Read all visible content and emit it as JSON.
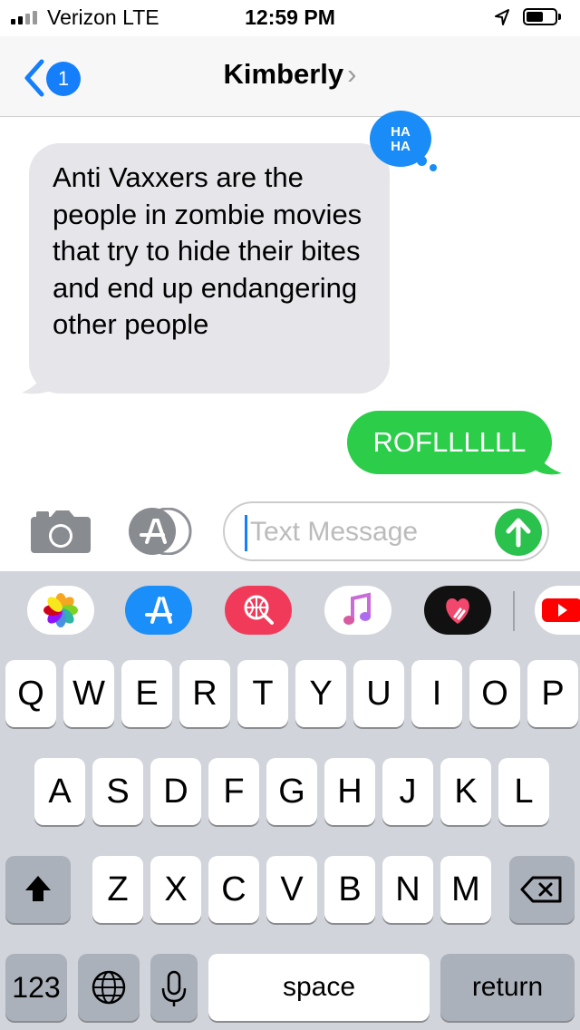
{
  "status_bar": {
    "carrier": "Verizon  LTE",
    "time": "12:59 PM"
  },
  "nav": {
    "back_count": "1",
    "contact": "Kimberly",
    "chevron": "›"
  },
  "messages": {
    "incoming": "Anti Vaxxers are the people in zombie movies that try to hide their bites and end up endangering other people",
    "outgoing": "ROFLLLLLL",
    "tapback": "HA HA"
  },
  "composer": {
    "placeholder": "Text Message"
  },
  "keyboard": {
    "row1": [
      "Q",
      "W",
      "E",
      "R",
      "T",
      "Y",
      "U",
      "I",
      "O",
      "P"
    ],
    "row2": [
      "A",
      "S",
      "D",
      "F",
      "G",
      "H",
      "J",
      "K",
      "L"
    ],
    "row3": [
      "Z",
      "X",
      "C",
      "V",
      "B",
      "N",
      "M"
    ],
    "numbers_key": "123",
    "space_key": "space",
    "return_key": "return"
  },
  "colors": {
    "accent": "#147efb",
    "sent": "#2bcd49",
    "received": "#e5e5ea"
  }
}
